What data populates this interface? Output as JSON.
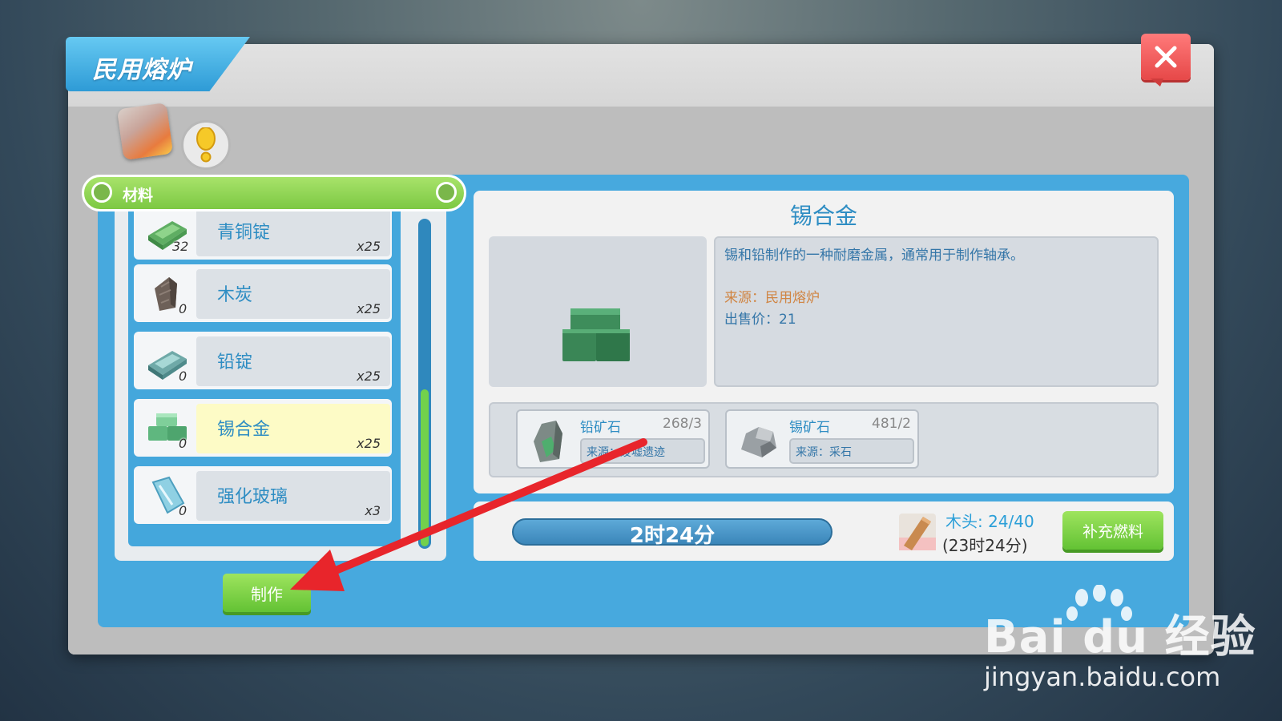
{
  "window": {
    "title": "民用熔炉",
    "close_label": "X"
  },
  "list": {
    "header": "材料",
    "items": [
      {
        "name": "青铜锭",
        "count": "32",
        "need": "x25",
        "icon": "bronze-ingot-icon"
      },
      {
        "name": "木炭",
        "count": "0",
        "need": "x25",
        "icon": "charcoal-icon"
      },
      {
        "name": "铅锭",
        "count": "0",
        "need": "x25",
        "icon": "lead-ingot-icon"
      },
      {
        "name": "锡合金",
        "count": "0",
        "need": "x25",
        "icon": "tin-alloy-icon",
        "selected": true
      },
      {
        "name": "强化玻璃",
        "count": "0",
        "need": "x3",
        "icon": "reinforced-glass-icon"
      }
    ],
    "make_label": "制作"
  },
  "detail": {
    "title": "锡合金",
    "description": "锡和铅制作的一种耐磨金属，通常用于制作轴承。",
    "source": "来源：民用熔炉",
    "price": "出售价：21",
    "ingredients": [
      {
        "name": "铅矿石",
        "count": "268/3",
        "source": "来源：废墟遗迹",
        "icon": "lead-ore-icon"
      },
      {
        "name": "锡矿石",
        "count": "481/2",
        "source": "来源：采石",
        "icon": "tin-ore-icon"
      }
    ]
  },
  "fuel": {
    "timer": "2时24分",
    "wood": "木头: 24/40",
    "wood_time": "(23时24分)",
    "refuel_label": "补充燃料"
  },
  "watermark": {
    "logo": "Bai du 经验",
    "url": "jingyan.baidu.com"
  },
  "colors": {
    "accent_blue": "#47a9de",
    "green": "#7cc843",
    "text_blue": "#2e8dc3",
    "close_red": "#e64848"
  }
}
